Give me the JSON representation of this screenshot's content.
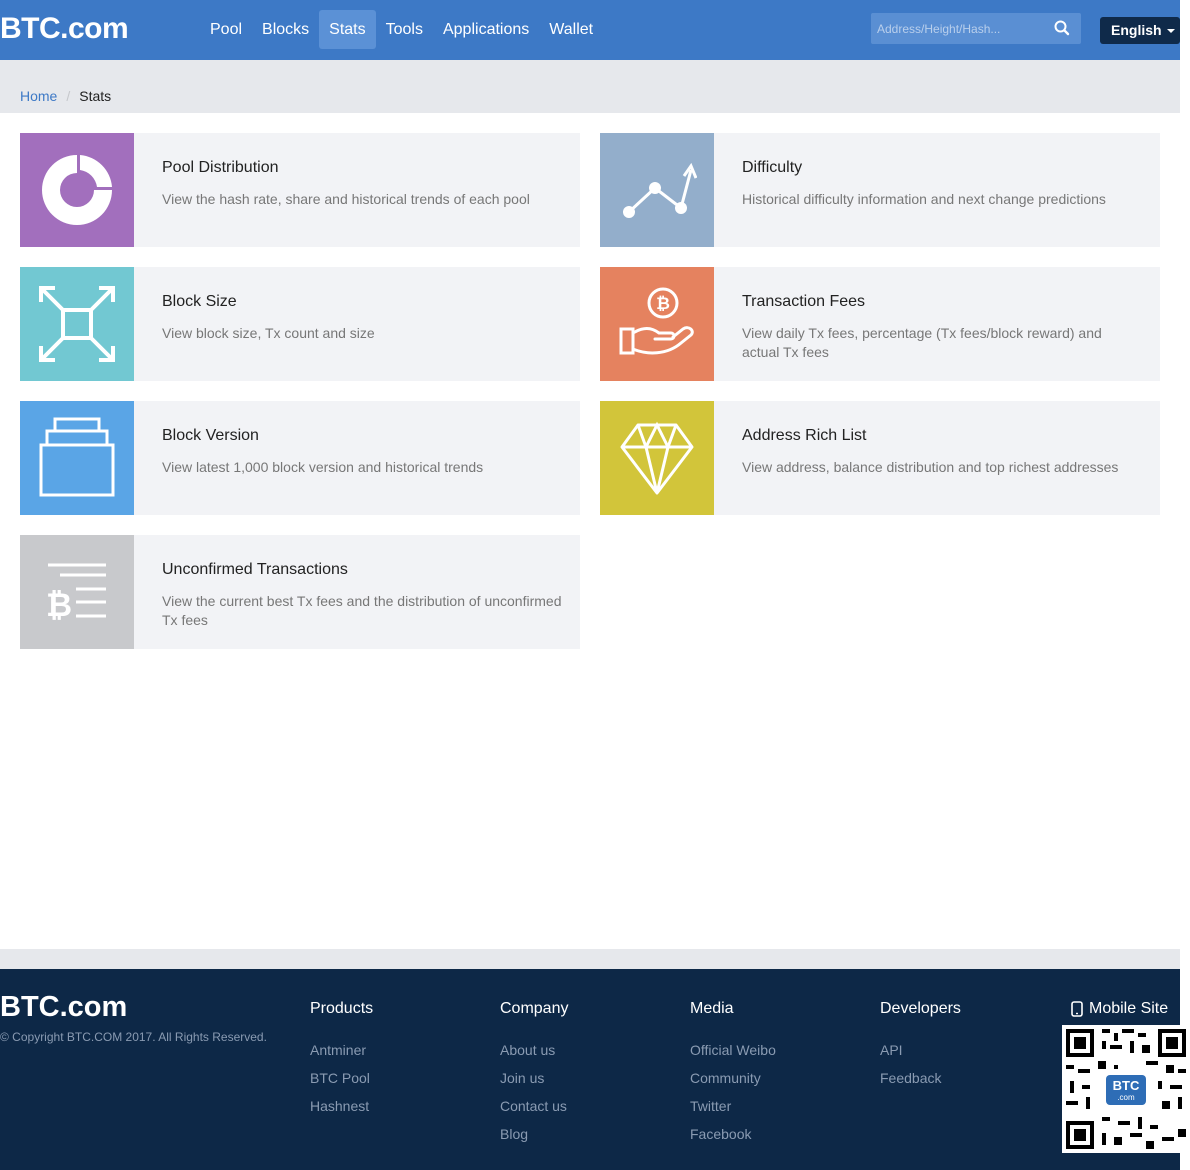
{
  "header": {
    "logo": "BTC.com",
    "nav": [
      {
        "label": "Pool",
        "active": false
      },
      {
        "label": "Blocks",
        "active": false
      },
      {
        "label": "Stats",
        "active": true
      },
      {
        "label": "Tools",
        "active": false
      },
      {
        "label": "Applications",
        "active": false
      },
      {
        "label": "Wallet",
        "active": false
      }
    ],
    "search_placeholder": "Address/Height/Hash...",
    "language": "English"
  },
  "breadcrumb": {
    "home": "Home",
    "separator": "/",
    "current": "Stats"
  },
  "cards": [
    {
      "title": "Pool Distribution",
      "desc": "View the hash rate,  share and historical trends of each pool",
      "color": "#a26fbd",
      "icon": "pie-chart-icon"
    },
    {
      "title": "Difficulty",
      "desc": "Historical difficulty information and next change predictions",
      "color": "#93aecb",
      "icon": "trend-line-icon"
    },
    {
      "title": "Block Size",
      "desc": "View block size,  Tx count and size",
      "color": "#72c8d2",
      "icon": "expand-arrows-icon"
    },
    {
      "title": "Transaction Fees",
      "desc": "View daily Tx fees,  percentage (Tx fees/block reward) and actual Tx fees",
      "color": "#e5825f",
      "icon": "hand-bitcoin-icon"
    },
    {
      "title": "Block Version",
      "desc": "View latest 1,000 block version and historical trends",
      "color": "#5aa5e6",
      "icon": "stacked-layers-icon"
    },
    {
      "title": "Address Rich List",
      "desc": "View address,  balance distribution and top richest addresses",
      "color": "#d2c53a",
      "icon": "diamond-icon"
    },
    {
      "title": "Unconfirmed Transactions",
      "desc": "View the current best Tx fees and the distribution of unconfirmed Tx fees",
      "color": "#c8c9cc",
      "icon": "bitcoin-list-icon"
    }
  ],
  "footer": {
    "logo": "BTC.com",
    "copyright": "© Copyright BTC.COM 2017. All Rights Reserved.",
    "columns": [
      {
        "title": "Products",
        "links": [
          "Antminer",
          "BTC Pool",
          "Hashnest"
        ]
      },
      {
        "title": "Company",
        "links": [
          "About us",
          "Join us",
          "Contact us",
          "Blog"
        ]
      },
      {
        "title": "Media",
        "links": [
          "Official Weibo",
          "Community",
          "Twitter",
          "Facebook"
        ]
      },
      {
        "title": "Developers",
        "links": [
          "API",
          "Feedback"
        ]
      }
    ],
    "mobile_site": "Mobile Site",
    "qr_badge": "BTC",
    "qr_badge_sub": ".com"
  }
}
